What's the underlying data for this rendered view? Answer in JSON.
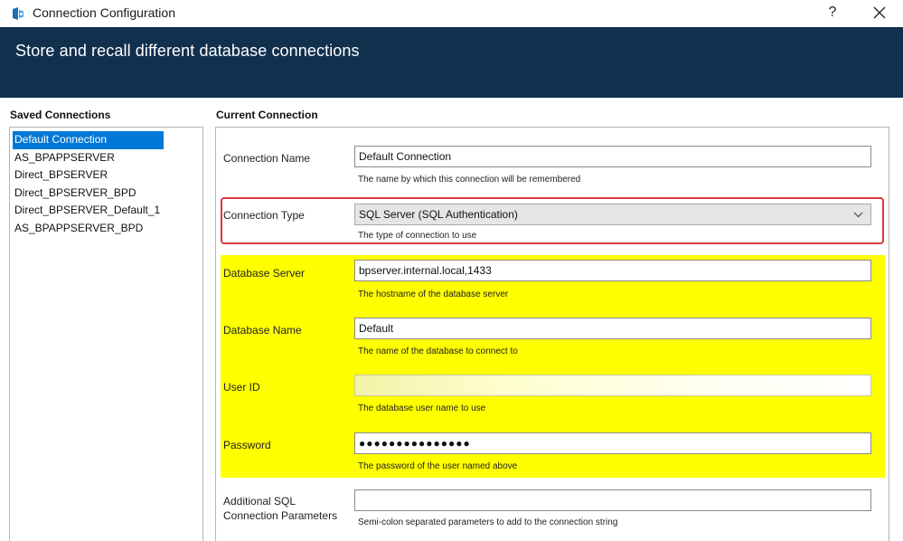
{
  "window": {
    "title": "Connection Configuration",
    "help_label": "?"
  },
  "banner": {
    "title": "Store and recall different database connections"
  },
  "saved_connections": {
    "heading": "Saved Connections",
    "items": [
      {
        "label": "Default Connection",
        "selected": true
      },
      {
        "label": "AS_BPAPPSERVER",
        "selected": false
      },
      {
        "label": "Direct_BPSERVER",
        "selected": false
      },
      {
        "label": "Direct_BPSERVER_BPD",
        "selected": false
      },
      {
        "label": "Direct_BPSERVER_Default_1",
        "selected": false
      },
      {
        "label": "AS_BPAPPSERVER_BPD",
        "selected": false
      }
    ]
  },
  "current_connection": {
    "heading": "Current Connection",
    "connection_name": {
      "label": "Connection Name",
      "value": "Default Connection",
      "help": "The name by which this connection will be remembered"
    },
    "connection_type": {
      "label": "Connection Type",
      "value": "SQL Server (SQL Authentication)",
      "help": "The type of connection to use"
    },
    "database_server": {
      "label": "Database Server",
      "value": "bpserver.internal.local,1433",
      "help": "The hostname of the database server"
    },
    "database_name": {
      "label": "Database Name",
      "value": "Default",
      "help": "The name of the database to connect to"
    },
    "user_id": {
      "label": "User ID",
      "value": "",
      "help": "The database user name to use"
    },
    "password": {
      "label": "Password",
      "masked_value": "●●●●●●●●●●●●●●●",
      "help": "The password of the user named above"
    },
    "additional_params": {
      "label_line1": "Additional SQL",
      "label_line2": "Connection Parameters",
      "value": "",
      "help": "Semi-colon separated parameters to add to the connection string"
    }
  },
  "colors": {
    "banner": "#11304e",
    "selection": "#0078d7",
    "highlight": "#ffff00",
    "annotation_border": "#d9383f"
  }
}
